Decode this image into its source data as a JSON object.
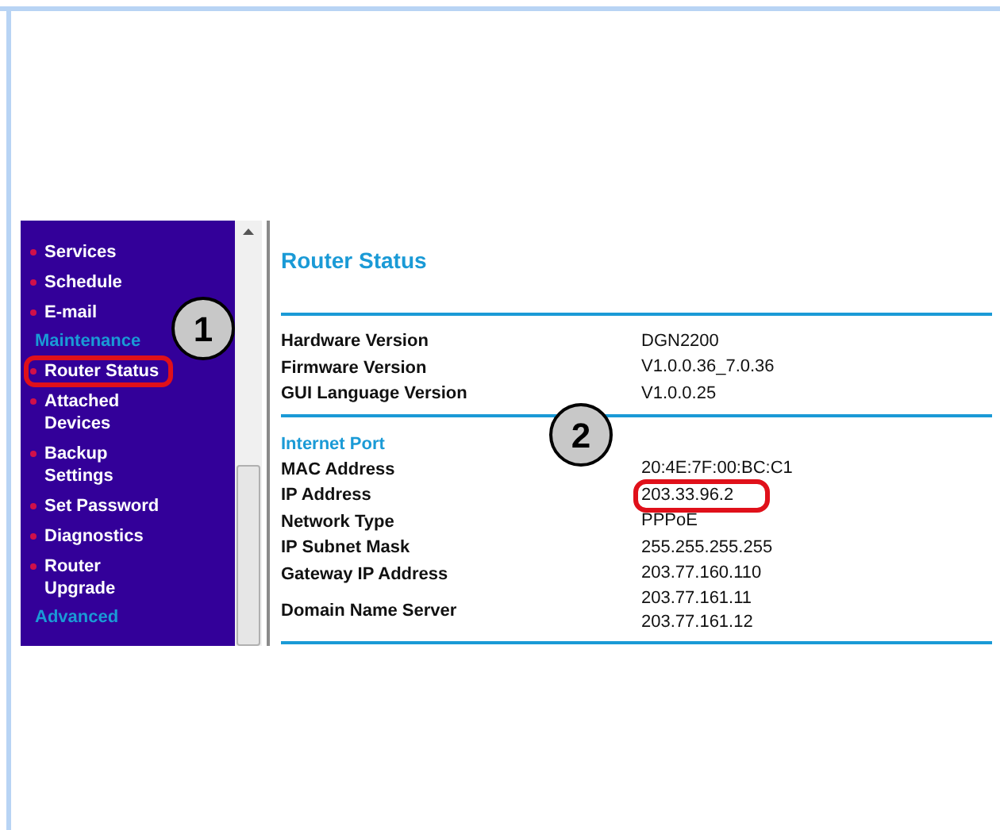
{
  "sidebar": {
    "items": [
      {
        "kind": "link",
        "label": "Services",
        "highlighted": false
      },
      {
        "kind": "link",
        "label": "Schedule",
        "highlighted": false
      },
      {
        "kind": "link",
        "label": "E-mail",
        "highlighted": false
      },
      {
        "kind": "heading",
        "label": "Maintenance"
      },
      {
        "kind": "link",
        "label": "Router Status",
        "highlighted": true
      },
      {
        "kind": "link",
        "label": "Attached Devices",
        "highlighted": false
      },
      {
        "kind": "link",
        "label": "Backup Settings",
        "highlighted": false
      },
      {
        "kind": "link",
        "label": "Set Password",
        "highlighted": false
      },
      {
        "kind": "link",
        "label": "Diagnostics",
        "highlighted": false
      },
      {
        "kind": "link",
        "label": "Router Upgrade",
        "highlighted": false
      },
      {
        "kind": "heading",
        "label": "Advanced"
      }
    ]
  },
  "page": {
    "title": "Router Status",
    "sections": [
      {
        "rows": [
          {
            "label": "Hardware Version",
            "values": [
              "DGN2200"
            ],
            "highlighted": false
          },
          {
            "label": "Firmware Version",
            "values": [
              "V1.0.0.36_7.0.36"
            ],
            "highlighted": false
          },
          {
            "label": "GUI Language Version",
            "values": [
              "V1.0.0.25"
            ],
            "highlighted": false
          }
        ]
      },
      {
        "heading": "Internet Port",
        "rows": [
          {
            "label": "MAC Address",
            "values": [
              "20:4E:7F:00:BC:C1"
            ],
            "highlighted": false
          },
          {
            "label": "IP Address",
            "values": [
              "203.33.96.2"
            ],
            "highlighted": true
          },
          {
            "label": "Network Type",
            "values": [
              "PPPoE"
            ],
            "highlighted": false
          },
          {
            "label": "IP Subnet Mask",
            "values": [
              "255.255.255.255"
            ],
            "highlighted": false
          },
          {
            "label": "Gateway IP Address",
            "values": [
              "203.77.160.110"
            ],
            "highlighted": false
          },
          {
            "label": "Domain Name Server",
            "values": [
              "203.77.161.11",
              "203.77.161.12"
            ],
            "highlighted": false
          }
        ]
      }
    ]
  },
  "callouts": [
    {
      "label": "1"
    },
    {
      "label": "2"
    }
  ]
}
